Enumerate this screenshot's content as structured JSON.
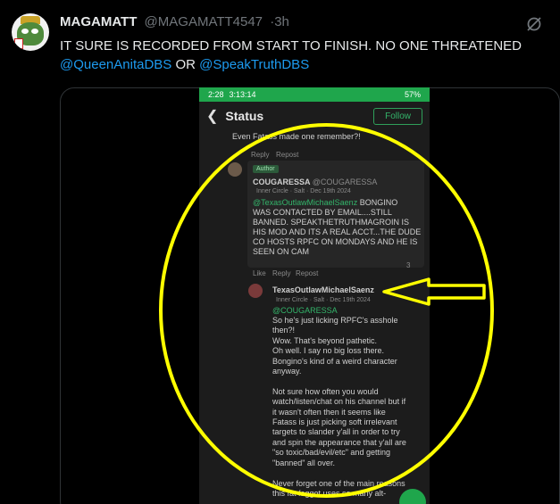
{
  "tweet": {
    "display_name": "MAGAMATT",
    "handle": "@MAGAMATT4547",
    "separator": "·",
    "time": "3h",
    "text_prefix": "IT SURE IS RECORDED FROM START TO FINISH. NO ONE THREATENED",
    "mention_1": "@QueenAnitaDBS",
    "text_mid": " OR ",
    "mention_2": "@SpeakTruthDBS"
  },
  "phone": {
    "status_time": "2:28",
    "status_timer": "3:13:14",
    "battery": "57%",
    "nav_title": "Status",
    "follow_label": "Follow",
    "prev_snippet": "Even Fatass made one remember?!",
    "reply_label": "Reply",
    "repost_label": "Repost",
    "like_label": "Like",
    "comment1": {
      "badge": "Author",
      "name": "COUGARESSA",
      "handle": "@COUGARESSA",
      "meta": "Inner Circle · Salt · Dec 19th 2024",
      "mention": "@TexasOutlawMichaelSaenz",
      "lines": [
        "BONGINO",
        "WAS CONTACTED BY EMAIL....STILL",
        "BANNED. SPEAKTHETRUTHMAGROIN IS",
        "HIS MOD AND ITS A REAL ACCT...THE DUDE",
        "CO HOSTS RPFC ON MONDAYS AND HE IS",
        "SEEN ON CAM"
      ],
      "likes": "3"
    },
    "comment2": {
      "name": "TexasOutlawMichaelSaenz",
      "meta": "Inner Circle · Salt · Dec 19th 2024",
      "mention": "@COUGARESSA",
      "lines": [
        "So he's just licking RPFC's asshole",
        "then?!",
        "Wow. That's beyond pathetic.",
        "Oh well. I say no big loss there.",
        "Bongino's kind of a weird character",
        "anyway.",
        "",
        "Not sure how often you would",
        "watch/listen/chat on his channel but if",
        "it wasn't often then it seems like",
        "Fatass is just picking soft irrelevant",
        "targets to slander y'all in order to try",
        "and spin the appearance that y'all are",
        "\"so toxic/bad/evil/etc\" and getting",
        "\"banned\" all over.",
        "",
        "Never forget one of the main reasons",
        "this fat faggot uses so many alt-"
      ]
    }
  },
  "colors": {
    "accent_blue": "#1d9bf0",
    "annotation_yellow": "#ffff00",
    "status_green": "#1fa64c"
  },
  "icons": {
    "grok": "grok-slash-icon",
    "back": "back-arrow-icon"
  }
}
